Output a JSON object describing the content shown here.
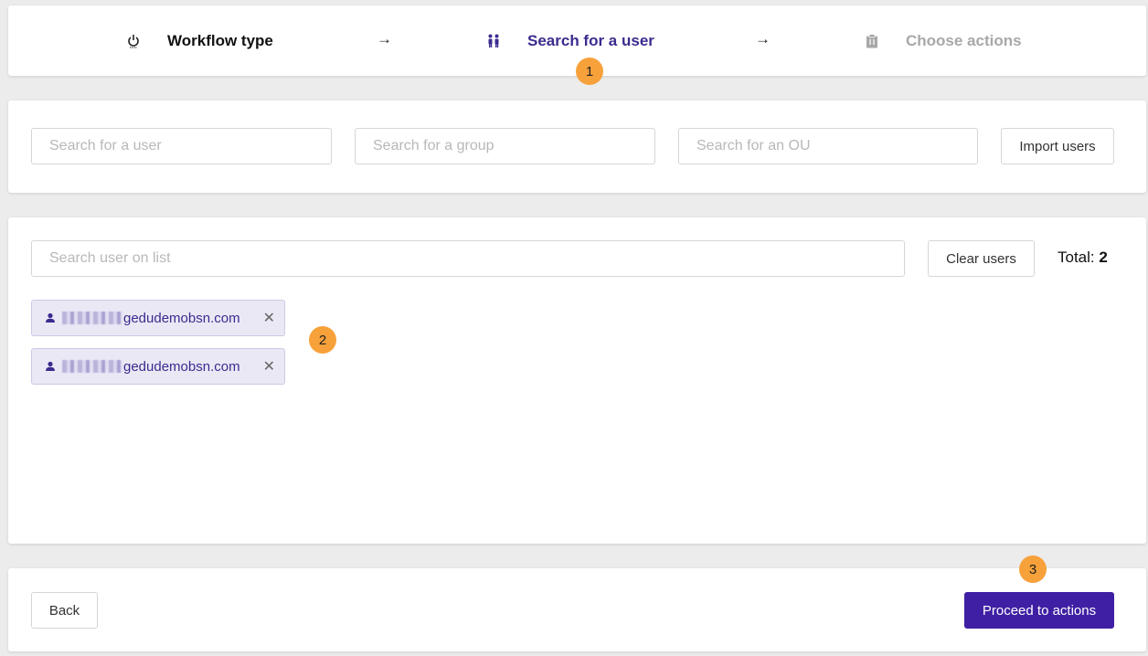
{
  "stepper": {
    "steps": [
      {
        "label": "Workflow type",
        "icon": "power-icon",
        "state": "done",
        "color": "#111111"
      },
      {
        "label": "Search for a user",
        "icon": "users-icon",
        "state": "active",
        "color": "#3b2b8f"
      },
      {
        "label": "Choose actions",
        "icon": "clipboard-icon",
        "state": "upcoming",
        "color": "#a8a8a8"
      }
    ],
    "arrow": "→"
  },
  "annotations": [
    "1",
    "2",
    "3"
  ],
  "search": {
    "user_placeholder": "Search for a user",
    "group_placeholder": "Search for a group",
    "ou_placeholder": "Search for an OU",
    "import_label": "Import users"
  },
  "list": {
    "filter_placeholder": "Search user on list",
    "clear_label": "Clear users",
    "total_label": "Total:",
    "total_value": "2",
    "users": [
      {
        "domain": "gedudemobsn.com"
      },
      {
        "domain": "gedudemobsn.com"
      }
    ],
    "remove_glyph": "✕"
  },
  "footer": {
    "back_label": "Back",
    "proceed_label": "Proceed to actions"
  },
  "colors": {
    "accent": "#3f1fa3",
    "badge": "#f7a13b",
    "chip_bg": "#ebe8f5"
  }
}
